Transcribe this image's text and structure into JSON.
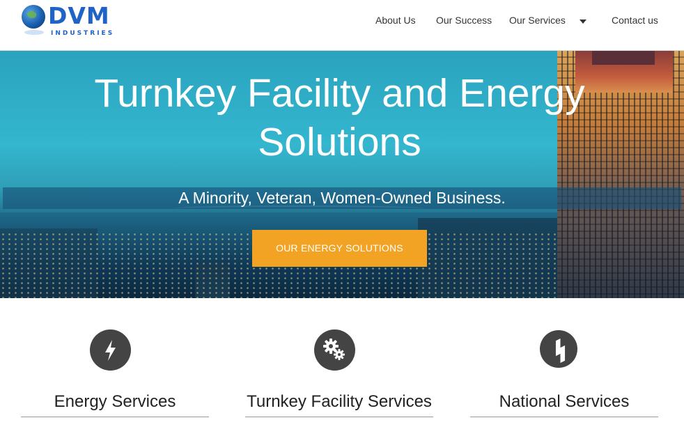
{
  "logo": {
    "name": "DVM",
    "subtitle": "INDUSTRIES"
  },
  "nav": {
    "about": "About Us",
    "success": "Our Success",
    "services": "Our Services",
    "contact": "Contact us"
  },
  "hero": {
    "title": "Turnkey Facility and Energy Solutions",
    "tagline": "A Minority, Veteran, Women-Owned Business.",
    "cta": "OUR ENERGY SOLUTIONS"
  },
  "services": [
    {
      "title": "Energy Services",
      "icon": "lightning-bolt-icon"
    },
    {
      "title": "Turnkey Facility Services",
      "icon": "gears-icon"
    },
    {
      "title": "National Services",
      "icon": "houzz-logo-icon"
    }
  ],
  "colors": {
    "accent": "#f3a323",
    "brand": "#1f63c6",
    "icon_bg": "#444444"
  }
}
